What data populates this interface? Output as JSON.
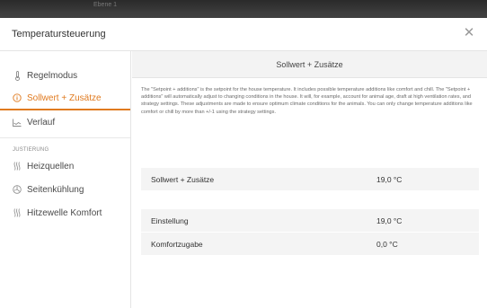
{
  "background": {
    "tab_hint": "Ebene 1"
  },
  "dialog": {
    "title": "Temperatursteuerung",
    "close_icon": "close-icon"
  },
  "sidebar": {
    "items": [
      {
        "label": "Regelmodus",
        "icon": "thermometer-icon",
        "active": false
      },
      {
        "label": "Sollwert + Zusätze",
        "icon": "info-circle-icon",
        "active": true
      },
      {
        "label": "Verlauf",
        "icon": "line-chart-icon",
        "active": false
      }
    ],
    "section_label": "JUSTIERUNG",
    "adjust_items": [
      {
        "label": "Heizquellen",
        "icon": "heat-waves-icon"
      },
      {
        "label": "Seitenkühlung",
        "icon": "fan-icon"
      },
      {
        "label": "Hitzewelle Komfort",
        "icon": "heat-waves-icon"
      }
    ]
  },
  "main": {
    "header": "Sollwert + Zusätze",
    "description": "The \"Setpoint + additions\" is the setpoint for the house temperature. It includes possible temperature additions like comfort and chill. The \"Setpoint + additions\" will automatically adjust to changing conditions in the house. It will, for example, account for animal age, draft at high ventilation rates, and strategy settings. These adjustments are made to ensure optimum climate conditions for the animals. You can only change temperature additions like comfort or chill by more than +/-1 using the strategy settings.",
    "summary": {
      "label": "Sollwert + Zusätze",
      "value": "19,0 °C"
    },
    "details": [
      {
        "label": "Einstellung",
        "value": "19,0 °C"
      },
      {
        "label": "Komfortzugabe",
        "value": "0,0 °C"
      }
    ]
  },
  "colors": {
    "accent": "#e07a1f"
  }
}
